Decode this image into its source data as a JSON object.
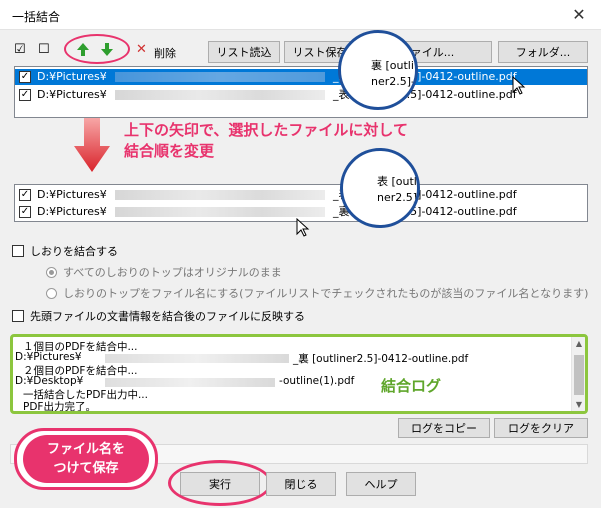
{
  "window": {
    "title": "一括結合",
    "close_glyph": "✕"
  },
  "toolbar": {
    "check_all_glyph": "☑",
    "uncheck_all_glyph": "☐",
    "up_icon": "arrow-up-icon",
    "down_icon": "arrow-down-icon",
    "delete_glyph": "✕",
    "delete_label": "削除",
    "load_list_label": "リスト読込",
    "save_list_label": "リスト保存",
    "file_label": "ファイル...",
    "folder_label": "フォルダ..."
  },
  "top_list": {
    "rows": [
      {
        "path": "D:¥Pictures¥",
        "suffix": "_裏 [outliner2.5]-0412-outline.pdf",
        "selected": true
      },
      {
        "path": "D:¥Pictures¥",
        "suffix": "_表 [outliner2.5]-0412-outline.pdf",
        "selected": false
      }
    ],
    "lens": {
      "line1": "裏 [outli",
      "line2": "ner2.5]-0412-outline.pdf"
    }
  },
  "callout": {
    "line1": "上下の矢印で、選択したファイルに対して",
    "line2": "結合順を変更"
  },
  "bottom_list": {
    "rows": [
      {
        "path": "D:¥Pictures¥",
        "suffix": "_表 [outliner2.5]-0412-outline.pdf"
      },
      {
        "path": "D:¥Pictures¥",
        "suffix": "_裏 [outliner2.5]-0412-outline.pdf"
      }
    ],
    "lens": {
      "line1": "表 [outli",
      "line2": "ner2.5]-0412-outline.pdf"
    }
  },
  "options": {
    "merge_bookmarks": "しおりを結合する",
    "radio_keep": "すべてのしおりのトップはオリジナルのまま",
    "radio_filename": "しおりのトップをファイル名にする(ファイルリストでチェックされたものが該当のファイル名となります)",
    "reflect_docinfo": "先頭ファイルの文書情報を結合後のファイルに反映する"
  },
  "log": {
    "lines": [
      "１個目のPDFを結合中...",
      "D:¥Pictures¥",
      "_裏 [outliner2.5]-0412-outline.pdf",
      "２個目のPDFを結合中...",
      "D:¥Desktop¥",
      "-outline(1).pdf",
      "一括結合したPDF出力中...",
      "PDF出力完了。"
    ],
    "label": "結合ログ"
  },
  "log_buttons": {
    "copy": "ログをコピー",
    "clear": "ログをクリア"
  },
  "bottom_buttons": {
    "run": "実行",
    "close": "閉じる",
    "help": "ヘルプ"
  },
  "bubble": {
    "line1": "ファイル名を",
    "line2": "つけて保存"
  },
  "colors": {
    "accent_pink": "#e8336d",
    "log_green": "#8cc63e",
    "selection_blue": "#0078d7",
    "arrow_green": "#2e9e2e"
  }
}
